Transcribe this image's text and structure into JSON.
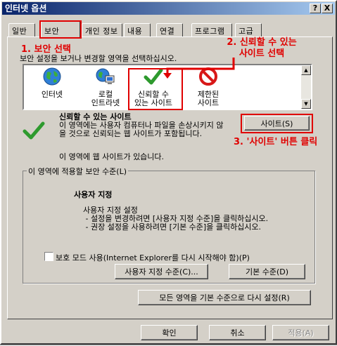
{
  "window": {
    "title": "인터넷 옵션",
    "help_label": "?",
    "close_label": "X"
  },
  "tabs": [
    {
      "label": "일반"
    },
    {
      "label": "보안"
    },
    {
      "label": "개인 정보"
    },
    {
      "label": "내용"
    },
    {
      "label": "연결"
    },
    {
      "label": "프로그램"
    },
    {
      "label": "고급"
    }
  ],
  "instruction": "보안 설정을 보거나 변경할 영역을 선택하십시오.",
  "zones": [
    {
      "label": "인터넷",
      "icon": "globe-icon"
    },
    {
      "label": "로컬\n인트라넷",
      "icon": "intranet-icon"
    },
    {
      "label": "신뢰할 수\n있는 사이트",
      "icon": "checkmark-icon"
    },
    {
      "label": "제한된\n사이트",
      "icon": "restricted-icon"
    }
  ],
  "selected_zone": {
    "title": "신뢰할 수 있는 사이트",
    "description": "이 영역에는 사용자 컴퓨터나 파일을 손상시키지 않을 것으로 신뢰되는 웹 사이트가 포함됩니다.",
    "note": "이 영역에 웹 사이트가 있습니다."
  },
  "buttons": {
    "sites": "사이트(S)",
    "custom_level": "사용자 지정 수준(C)...",
    "default_level": "기본 수준(D)",
    "reset_all": "모든 영역을 기본 수준으로 다시 설정(R)",
    "ok": "확인",
    "cancel": "취소",
    "apply": "적용(A)"
  },
  "security_level": {
    "legend": "이 영역에 적용할 보안 수준(L)",
    "title": "사용자 지정",
    "text": "사용자 지정 설정\n - 설정을 변경하려면 [사용자 지정 수준]을 클릭하십시오.\n - 권장 설정을 사용하려면 [기본 수준]을 클릭하십시오."
  },
  "protected_mode_label": "보호 모드 사용(Internet Explorer를 다시 시작해야 함)(P)",
  "annotations": {
    "step1": "1. 보안 선택",
    "step2": "2. 신뢰할 수 있는\n사이트 선택",
    "step3": "3. '사이트' 버튼 클릭"
  },
  "colors": {
    "annotation": "#e00000",
    "title_bar": "#0a246a",
    "face": "#d4d0c8"
  }
}
